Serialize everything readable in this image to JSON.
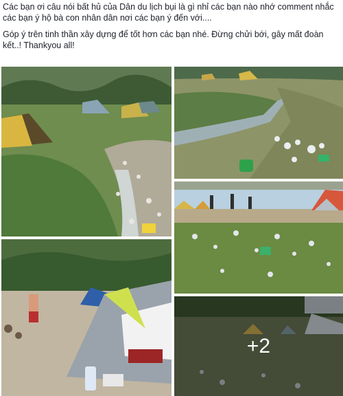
{
  "post": {
    "paragraph1": "Các bạn ơi câu nói bất hủ của Dân du lịch bụi là gì nhỉ các bạn nào nhớ comment nhắc các bạn ý hộ bà con nhân dân nơi các bạn ý đến với....",
    "paragraph2": "Góp ý trên tinh thần xây dựng để tốt hơn các bạn nhé. Đừng chửi bới, gây mất đoàn kết..! Thankyou all!"
  },
  "photos": {
    "more_count": "+2"
  }
}
